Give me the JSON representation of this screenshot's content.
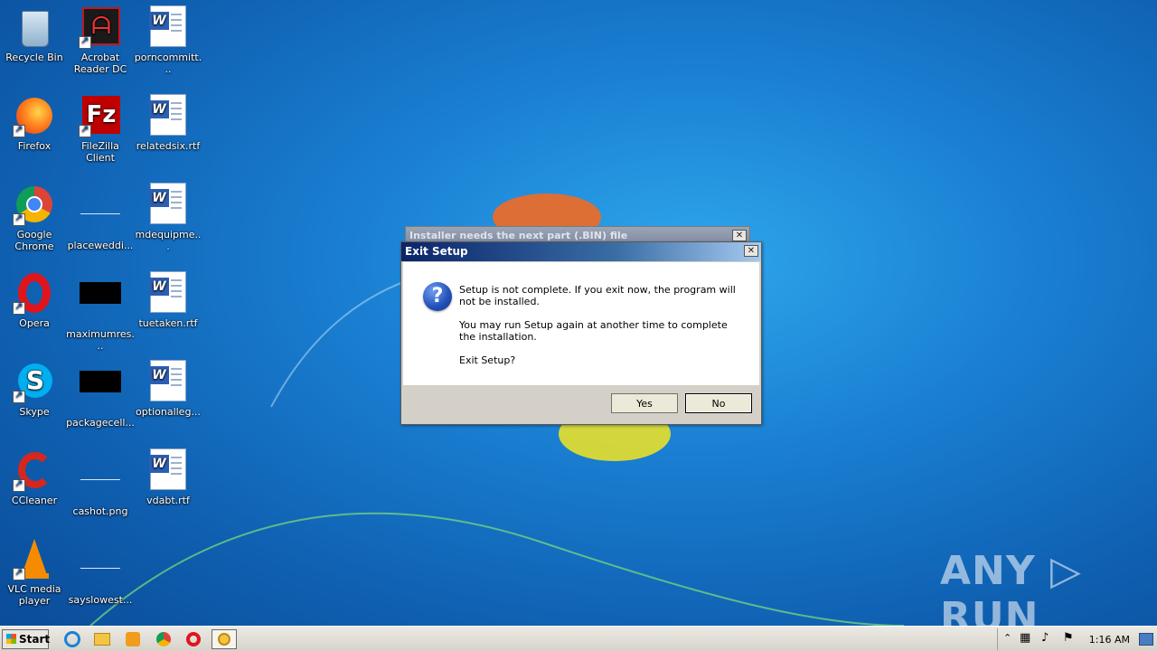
{
  "desktop": {
    "col1": [
      {
        "label": "Recycle Bin",
        "icon": "recycle-bin-icon"
      },
      {
        "label": "Firefox",
        "icon": "firefox-icon"
      },
      {
        "label": "Google Chrome",
        "icon": "chrome-icon"
      },
      {
        "label": "Opera",
        "icon": "opera-icon"
      },
      {
        "label": "Skype",
        "icon": "skype-icon"
      },
      {
        "label": "CCleaner",
        "icon": "ccleaner-icon"
      },
      {
        "label": "VLC media player",
        "icon": "vlc-icon"
      }
    ],
    "col2": [
      {
        "label": "Acrobat Reader DC",
        "icon": "acrobat-icon"
      },
      {
        "label": "FileZilla Client",
        "icon": "filezilla-icon"
      },
      {
        "label": "placeweddi...",
        "icon": "file-icon"
      },
      {
        "label": "maximumres...",
        "icon": "image-file-icon"
      },
      {
        "label": "packagecell...",
        "icon": "image-file-icon"
      },
      {
        "label": "cashot.png",
        "icon": "image-file-icon"
      },
      {
        "label": "sayslowest...",
        "icon": "file-icon"
      }
    ],
    "col3": [
      {
        "label": "porncommitt...",
        "icon": "word-doc-icon"
      },
      {
        "label": "relatedsix.rtf",
        "icon": "word-doc-icon"
      },
      {
        "label": "mdequipme...",
        "icon": "word-doc-icon"
      },
      {
        "label": "tuetaken.rtf",
        "icon": "word-doc-icon"
      },
      {
        "label": "optionalleg...",
        "icon": "word-doc-icon"
      },
      {
        "label": "vdabt.rtf",
        "icon": "word-doc-icon"
      }
    ]
  },
  "back_dialog": {
    "title": "Installer needs the next part (.BIN) file",
    "close": "✕"
  },
  "dialog": {
    "title": "Exit Setup",
    "close": "✕",
    "message1": "Setup is not complete. If you exit now, the program will not be installed.",
    "message2": "You may run Setup again at another time to complete the installation.",
    "message3": "Exit Setup?",
    "yes_label": "Yes",
    "no_label": "No"
  },
  "taskbar": {
    "start_label": "Start",
    "clock": "1:16 AM",
    "apps": [
      "ie-icon",
      "explorer-icon",
      "media-player-icon",
      "chrome-icon",
      "opera-icon",
      "setup-icon"
    ]
  },
  "watermark": "ANY ▷ RUN"
}
